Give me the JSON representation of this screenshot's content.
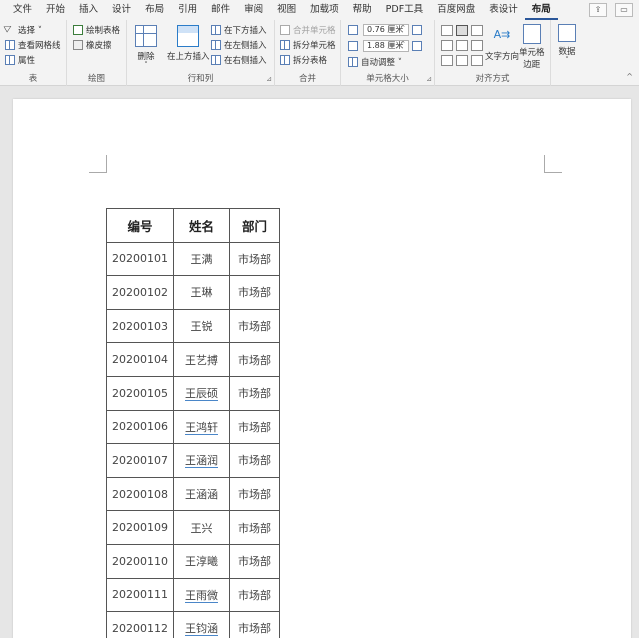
{
  "tabs": [
    {
      "label": "文件"
    },
    {
      "label": "开始"
    },
    {
      "label": "插入"
    },
    {
      "label": "设计"
    },
    {
      "label": "布局"
    },
    {
      "label": "引用"
    },
    {
      "label": "邮件"
    },
    {
      "label": "审阅"
    },
    {
      "label": "视图"
    },
    {
      "label": "加载项"
    },
    {
      "label": "帮助"
    },
    {
      "label": "PDF工具"
    },
    {
      "label": "百度网盘"
    },
    {
      "label": "表设计"
    },
    {
      "label": "布局"
    }
  ],
  "ribbon": {
    "table_group": {
      "select": "选择 ˅",
      "view_gridlines": "查看网格线",
      "properties": "属性",
      "label": "表"
    },
    "draw_group": {
      "draw_table": "绘制表格",
      "eraser": "橡皮擦",
      "label": "绘图"
    },
    "rows_cols_group": {
      "delete": "删除",
      "delete_arrow": "˅",
      "insert_above": "在上方插入",
      "insert_below": "在下方插入",
      "insert_left": "在左侧插入",
      "insert_right": "在右侧插入",
      "label": "行和列",
      "launcher": "⊿"
    },
    "merge_group": {
      "merge_cells": "合并单元格",
      "split_cells": "拆分单元格",
      "split_table": "拆分表格",
      "label": "合并"
    },
    "cell_size_group": {
      "height": "0.76 厘米",
      "width": "1.88 厘米",
      "autofit": "自动调整 ˅",
      "label": "单元格大小",
      "launcher": "⊿"
    },
    "alignment_group": {
      "text_direction": "文字方向",
      "cell_margins_line1": "单元格",
      "cell_margins_line2": "边距",
      "label": "对齐方式"
    },
    "data_group": {
      "data": "数据",
      "arrow": "˅"
    },
    "collapse": "^"
  },
  "table": {
    "headers": [
      "编号",
      "姓名",
      "部门"
    ],
    "rows": [
      [
        "20200101",
        "王满",
        "市场部"
      ],
      [
        "20200102",
        "王琳",
        "市场部"
      ],
      [
        "20200103",
        "王锐",
        "市场部"
      ],
      [
        "20200104",
        "王艺搏",
        "市场部"
      ],
      [
        "20200105",
        "王辰硕",
        "市场部"
      ],
      [
        "20200106",
        "王鸿轩",
        "市场部"
      ],
      [
        "20200107",
        "王涵润",
        "市场部"
      ],
      [
        "20200108",
        "王涵涵",
        "市场部"
      ],
      [
        "20200109",
        "王兴",
        "市场部"
      ],
      [
        "20200110",
        "王淳曦",
        "市场部"
      ],
      [
        "20200111",
        "王雨微",
        "市场部"
      ],
      [
        "20200112",
        "王钧涵",
        "市场部"
      ]
    ]
  }
}
